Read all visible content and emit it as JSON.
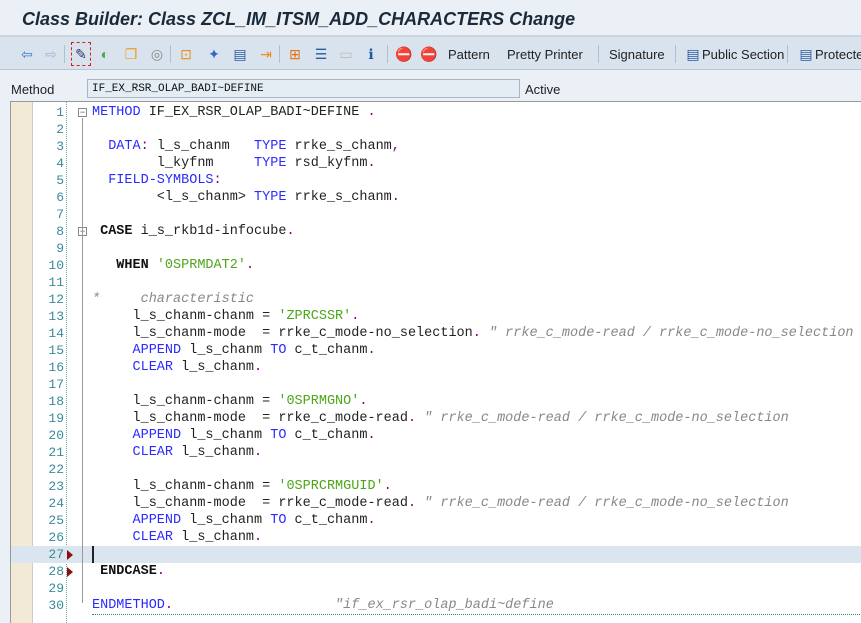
{
  "window": {
    "title": "Class Builder: Class ZCL_IM_ITSM_ADD_CHARACTERS Change"
  },
  "toolbar": {
    "icons": [
      "back-icon",
      "forward-icon",
      "display-change-icon",
      "activate-icon",
      "inactive-objects-icon",
      "where-used-icon",
      "object-list-icon",
      "magic-wand-icon",
      "insert-icon",
      "move-icon",
      "hierarchy-icon",
      "outline-icon",
      "list-icon",
      "info-icon",
      "stop-icon",
      "stop-session-icon"
    ],
    "pattern": "Pattern",
    "pretty_printer": "Pretty Printer",
    "signature": "Signature",
    "public_section": "Public Section",
    "protected_section": "Protecte"
  },
  "method": {
    "label": "Method",
    "value": "IF_EX_RSR_OLAP_BADI~DEFINE",
    "status": "Active"
  },
  "editor": {
    "cursor_line": 27,
    "breakpoint_lines": [
      27,
      28
    ],
    "lines": [
      [
        [
          "kw",
          "METHOD"
        ],
        [
          "id",
          " IF_EX_RSR_OLAP_BADI~DEFINE "
        ],
        [
          "p",
          "."
        ]
      ],
      [],
      [
        [
          "kw",
          "  DATA"
        ],
        [
          "p",
          ":"
        ],
        [
          "id",
          " l_s_chanm   "
        ],
        [
          "kw",
          "TYPE"
        ],
        [
          "id",
          " rrke_s_chanm"
        ],
        [
          "p",
          ","
        ]
      ],
      [
        [
          "id",
          "        l_kyfnm     "
        ],
        [
          "kw",
          "TYPE"
        ],
        [
          "id",
          " rsd_kyfnm"
        ],
        [
          "p",
          "."
        ]
      ],
      [
        [
          "kw",
          "  FIELD-SYMBOLS"
        ],
        [
          "p",
          ":"
        ]
      ],
      [
        [
          "id",
          "        <l_s_chanm> "
        ],
        [
          "kw",
          "TYPE"
        ],
        [
          "id",
          " rrke_s_chanm"
        ],
        [
          "p",
          "."
        ]
      ],
      [],
      [
        [
          "kwb",
          " CASE"
        ],
        [
          "id",
          " i_s_rkb1d-infocube"
        ],
        [
          "p",
          "."
        ]
      ],
      [],
      [
        [
          "kwb",
          "   WHEN"
        ],
        [
          "str",
          " '0SPRMDAT2'"
        ],
        [
          "p",
          "."
        ]
      ],
      [],
      [
        [
          "cm",
          "*     characteristic"
        ]
      ],
      [
        [
          "id",
          "     l_s_chanm-chanm = "
        ],
        [
          "str",
          "'ZPRCSSR'"
        ],
        [
          "p",
          "."
        ]
      ],
      [
        [
          "id",
          "     l_s_chanm-mode  = rrke_c_mode-no_selection"
        ],
        [
          "p",
          "."
        ],
        [
          "cm",
          " \" rrke_c_mode-read / rrke_c_mode-no_selection"
        ]
      ],
      [
        [
          "kw",
          "     APPEND"
        ],
        [
          "id",
          " l_s_chanm "
        ],
        [
          "kw",
          "TO"
        ],
        [
          "id",
          " c_t_chanm"
        ],
        [
          "p",
          "."
        ]
      ],
      [
        [
          "kw",
          "     CLEAR"
        ],
        [
          "id",
          " l_s_chanm"
        ],
        [
          "p",
          "."
        ]
      ],
      [],
      [
        [
          "id",
          "     l_s_chanm-chanm = "
        ],
        [
          "str",
          "'0SPRMGNO'"
        ],
        [
          "p",
          "."
        ]
      ],
      [
        [
          "id",
          "     l_s_chanm-mode  = rrke_c_mode-read"
        ],
        [
          "p",
          "."
        ],
        [
          "cm",
          " \" rrke_c_mode-read / rrke_c_mode-no_selection"
        ]
      ],
      [
        [
          "kw",
          "     APPEND"
        ],
        [
          "id",
          " l_s_chanm "
        ],
        [
          "kw",
          "TO"
        ],
        [
          "id",
          " c_t_chanm"
        ],
        [
          "p",
          "."
        ]
      ],
      [
        [
          "kw",
          "     CLEAR"
        ],
        [
          "id",
          " l_s_chanm"
        ],
        [
          "p",
          "."
        ]
      ],
      [],
      [
        [
          "id",
          "     l_s_chanm-chanm = "
        ],
        [
          "str",
          "'0SPRCRMGUID'"
        ],
        [
          "p",
          "."
        ]
      ],
      [
        [
          "id",
          "     l_s_chanm-mode  = rrke_c_mode-read"
        ],
        [
          "p",
          "."
        ],
        [
          "cm",
          " \" rrke_c_mode-read / rrke_c_mode-no_selection"
        ]
      ],
      [
        [
          "kw",
          "     APPEND"
        ],
        [
          "id",
          " l_s_chanm "
        ],
        [
          "kw",
          "TO"
        ],
        [
          "id",
          " c_t_chanm"
        ],
        [
          "p",
          "."
        ]
      ],
      [
        [
          "kw",
          "     CLEAR"
        ],
        [
          "id",
          " l_s_chanm"
        ],
        [
          "p",
          "."
        ]
      ],
      [],
      [
        [
          "kwb",
          " ENDCASE"
        ],
        [
          "p",
          "."
        ]
      ],
      [],
      [
        [
          "kw",
          "ENDMETHOD"
        ],
        [
          "p",
          "."
        ],
        [
          "cm",
          "                    \"if_ex_rsr_olap_badi~define"
        ]
      ]
    ]
  }
}
